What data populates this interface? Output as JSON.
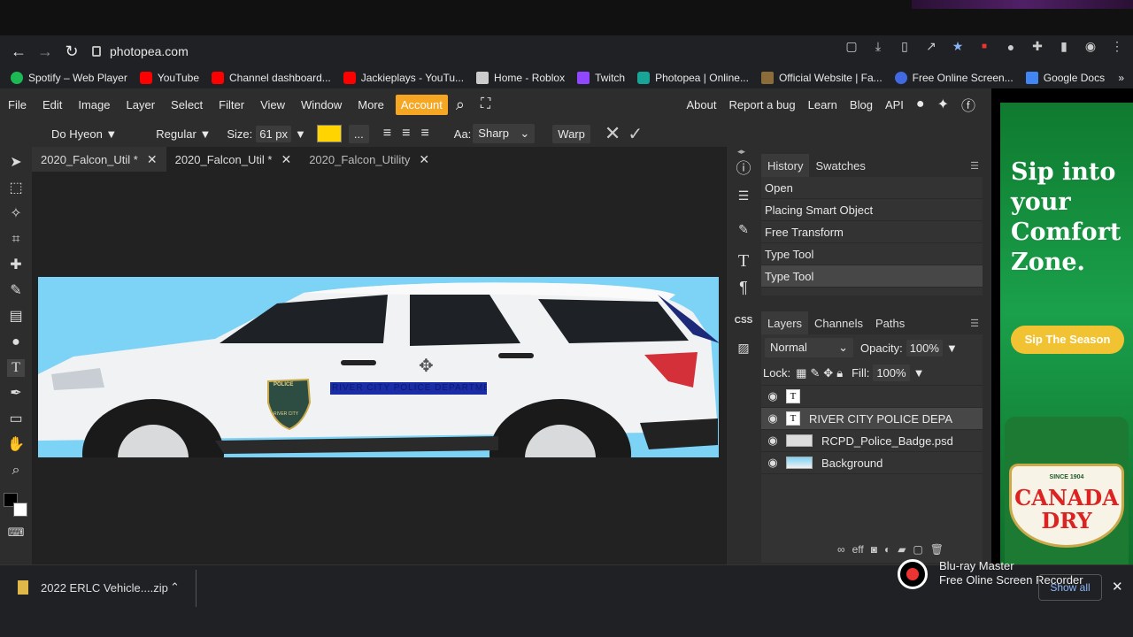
{
  "browser": {
    "url": "photopea.com",
    "bookmarks": [
      {
        "label": "Spotify – Web Player",
        "color": "#1db954"
      },
      {
        "label": "YouTube",
        "color": "#ff0000"
      },
      {
        "label": "Channel dashboard...",
        "color": "#ff0000"
      },
      {
        "label": "Jackieplays - YouTu...",
        "color": "#ff0000"
      },
      {
        "label": "Home - Roblox",
        "color": "#cccccc"
      },
      {
        "label": "Twitch",
        "color": "#9146ff"
      },
      {
        "label": "Photopea | Online...",
        "color": "#18a497"
      },
      {
        "label": "Official Website | Fa...",
        "color": "#8a6d3b"
      },
      {
        "label": "Free Online Screen...",
        "color": "#4169e1"
      },
      {
        "label": "Google Docs",
        "color": "#4285f4"
      }
    ]
  },
  "menu": {
    "items": [
      "File",
      "Edit",
      "Image",
      "Layer",
      "Select",
      "Filter",
      "View",
      "Window",
      "More"
    ],
    "account": "Account",
    "right": [
      "About",
      "Report a bug",
      "Learn",
      "Blog",
      "API"
    ]
  },
  "options": {
    "font": "Do Hyeon",
    "style": "Regular",
    "size_label": "Size:",
    "size_value": "61 px",
    "more": "...",
    "aa_label": "Aa:",
    "aa_value": "Sharp",
    "warp": "Warp",
    "text_color": "#ffd400"
  },
  "doc_tabs": [
    {
      "label": "2020_Falcon_Util *"
    },
    {
      "label": "2020_Falcon_Util *"
    },
    {
      "label": "2020_Falcon_Utility"
    }
  ],
  "canvas": {
    "text": "RIVER CITY POLICE DEPARTMENT",
    "badge_top": "POLICE",
    "badge_bottom": "RIVER CITY"
  },
  "history": {
    "tabs": [
      "History",
      "Swatches"
    ],
    "items": [
      "Open",
      "Placing Smart Object",
      "Free Transform",
      "Type Tool",
      "Type Tool"
    ]
  },
  "layers": {
    "tabs": [
      "Layers",
      "Channels",
      "Paths"
    ],
    "blend": "Normal",
    "opacity_label": "Opacity:",
    "opacity": "100%",
    "lock_label": "Lock:",
    "fill_label": "Fill:",
    "fill": "100%",
    "items": [
      {
        "name": ""
      },
      {
        "name": "RIVER CITY POLICE DEPA"
      },
      {
        "name": "RCPD_Police_Badge.psd"
      },
      {
        "name": "Background"
      }
    ]
  },
  "ad": {
    "headline": "Sip into your Comfort Zone.",
    "cta": "Sip The Season",
    "brand": "CANADA DRY",
    "since": "SINCE 1904"
  },
  "downloads": {
    "file": "2022 ERLC Vehicle....zip",
    "show_all": "Show all",
    "recorder_title": "Blu-ray Master",
    "recorder_sub": "Free Oline Screen Recorder"
  }
}
